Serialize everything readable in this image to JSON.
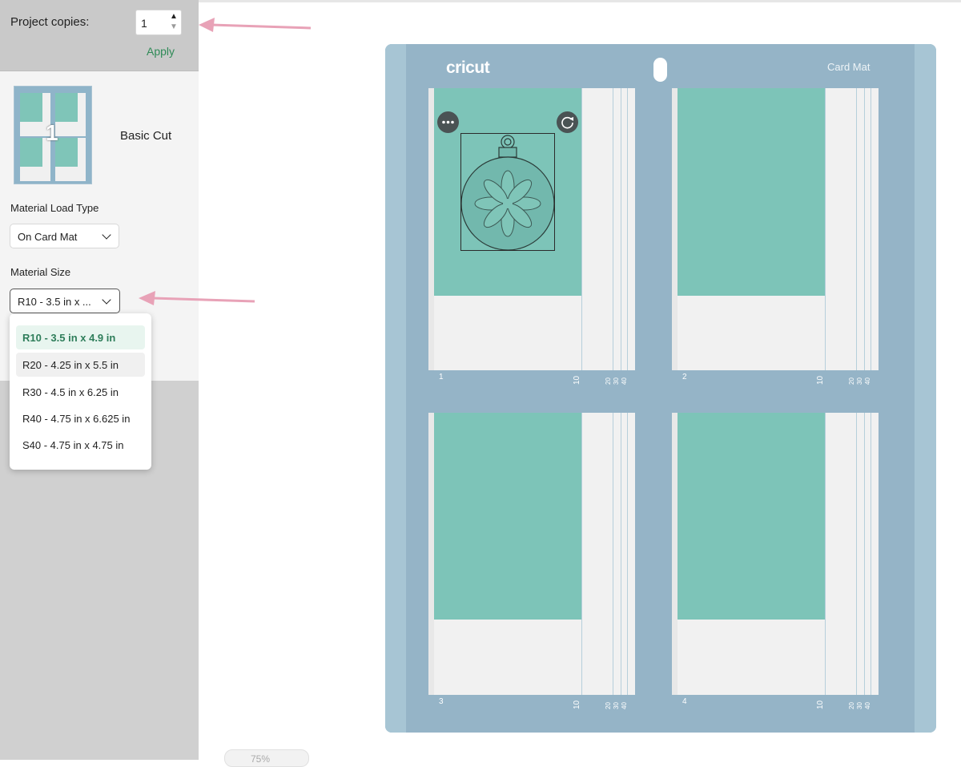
{
  "copies": {
    "label": "Project copies:",
    "value": "1",
    "apply_label": "Apply"
  },
  "mat_card": {
    "thumb_number": "1",
    "name": "Basic Cut"
  },
  "material_load": {
    "label": "Material Load Type",
    "value": "On Card Mat"
  },
  "material_size": {
    "label": "Material Size",
    "value": "R10 - 3.5 in x ...",
    "options": [
      {
        "label": "R10 - 3.5 in x 4.9 in",
        "selected": true
      },
      {
        "label": "R20 - 4.25 in x 5.5 in",
        "selected": false
      },
      {
        "label": "R30 - 4.5 in x 6.25 in",
        "selected": false
      },
      {
        "label": "R40 - 4.75 in x 6.625 in",
        "selected": false
      },
      {
        "label": "S40 - 4.75 in x 4.75 in",
        "selected": false
      }
    ]
  },
  "mat": {
    "brand": "cricut",
    "title": "Card Mat",
    "slots": [
      {
        "number": "1"
      },
      {
        "number": "2"
      },
      {
        "number": "3"
      },
      {
        "number": "4"
      }
    ],
    "ruler_label": "10",
    "ruler_small": [
      "20",
      "30",
      "40"
    ]
  },
  "zoom": {
    "label": "75%"
  },
  "colors": {
    "accent_green": "#2f8a57",
    "mat_blue": "#95b4c7",
    "card_teal": "#7dc4b8",
    "annotation_pink": "#e8a2b7"
  },
  "icons": {
    "more": "more-options-icon",
    "rotate": "rotate-icon",
    "chevron": "chevron-down-icon",
    "ornament": "ornament-design-icon"
  }
}
